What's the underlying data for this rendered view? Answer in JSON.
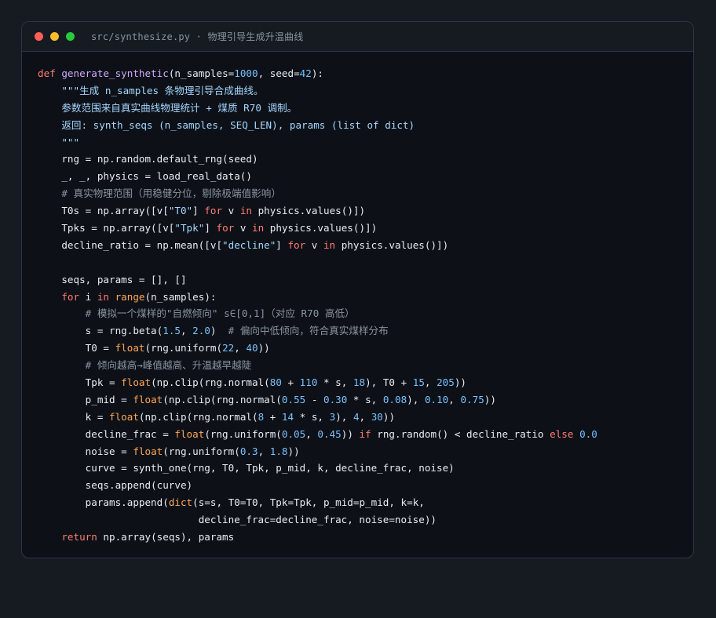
{
  "window": {
    "title": "src/synthesize.py · 物理引导生成升温曲线"
  },
  "colors": {
    "background": "#0d1117",
    "keyword": "#ff7b72",
    "function": "#d2a8ff",
    "number": "#79c0ff",
    "string": "#a5d6ff",
    "comment": "#8b949e",
    "builtin": "#ffa657",
    "plain": "#e6edf3"
  },
  "code": {
    "lines": [
      [
        [
          "kw",
          "def "
        ],
        [
          "fn",
          "generate_synthetic"
        ],
        [
          "pl",
          "(n_samples="
        ],
        [
          "num",
          "1000"
        ],
        [
          "pl",
          ", seed="
        ],
        [
          "num",
          "42"
        ],
        [
          "pl",
          "):"
        ]
      ],
      [
        [
          "str",
          "    \"\"\"生成 n_samples 条物理引导合成曲线。"
        ]
      ],
      [
        [
          "str",
          "    参数范围来自真实曲线物理统计 + 煤质 R70 调制。"
        ]
      ],
      [
        [
          "str",
          "    返回: synth_seqs (n_samples, SEQ_LEN), params (list of dict)"
        ]
      ],
      [
        [
          "str",
          "    \"\"\""
        ]
      ],
      [
        [
          "pl",
          "    rng = np.random.default_rng(seed)"
        ]
      ],
      [
        [
          "pl",
          "    _, _, physics = load_real_data()"
        ]
      ],
      [
        [
          "com",
          "    # 真实物理范围（用稳健分位，剔除极端值影响）"
        ]
      ],
      [
        [
          "pl",
          "    T0s = np.array([v["
        ],
        [
          "str",
          "\"T0\""
        ],
        [
          "pl",
          "] "
        ],
        [
          "kw",
          "for"
        ],
        [
          "pl",
          " v "
        ],
        [
          "kw",
          "in"
        ],
        [
          "pl",
          " physics.values()])"
        ]
      ],
      [
        [
          "pl",
          "    Tpks = np.array([v["
        ],
        [
          "str",
          "\"Tpk\""
        ],
        [
          "pl",
          "] "
        ],
        [
          "kw",
          "for"
        ],
        [
          "pl",
          " v "
        ],
        [
          "kw",
          "in"
        ],
        [
          "pl",
          " physics.values()])"
        ]
      ],
      [
        [
          "pl",
          "    decline_ratio = np.mean([v["
        ],
        [
          "str",
          "\"decline\""
        ],
        [
          "pl",
          "] "
        ],
        [
          "kw",
          "for"
        ],
        [
          "pl",
          " v "
        ],
        [
          "kw",
          "in"
        ],
        [
          "pl",
          " physics.values()])"
        ]
      ],
      [
        [
          "pl",
          ""
        ]
      ],
      [
        [
          "pl",
          "    seqs, params = [], []"
        ]
      ],
      [
        [
          "kw",
          "    for"
        ],
        [
          "pl",
          " i "
        ],
        [
          "kw",
          "in"
        ],
        [
          "pl",
          " "
        ],
        [
          "bi",
          "range"
        ],
        [
          "pl",
          "(n_samples):"
        ]
      ],
      [
        [
          "com",
          "        # 模拟一个煤样的\"自燃倾向\" s∈[0,1]（对应 R70 高低）"
        ]
      ],
      [
        [
          "pl",
          "        s = rng.beta("
        ],
        [
          "num",
          "1.5"
        ],
        [
          "pl",
          ", "
        ],
        [
          "num",
          "2.0"
        ],
        [
          "pl",
          ")  "
        ],
        [
          "com",
          "# 偏向中低倾向，符合真实煤样分布"
        ]
      ],
      [
        [
          "pl",
          "        T0 = "
        ],
        [
          "bi",
          "float"
        ],
        [
          "pl",
          "(rng.uniform("
        ],
        [
          "num",
          "22"
        ],
        [
          "pl",
          ", "
        ],
        [
          "num",
          "40"
        ],
        [
          "pl",
          "))"
        ]
      ],
      [
        [
          "com",
          "        # 倾向越高→峰值越高、升温越早越陡"
        ]
      ],
      [
        [
          "pl",
          "        Tpk = "
        ],
        [
          "bi",
          "float"
        ],
        [
          "pl",
          "(np.clip(rng.normal("
        ],
        [
          "num",
          "80"
        ],
        [
          "pl",
          " + "
        ],
        [
          "num",
          "110"
        ],
        [
          "pl",
          " * s, "
        ],
        [
          "num",
          "18"
        ],
        [
          "pl",
          "), T0 + "
        ],
        [
          "num",
          "15"
        ],
        [
          "pl",
          ", "
        ],
        [
          "num",
          "205"
        ],
        [
          "pl",
          "))"
        ]
      ],
      [
        [
          "pl",
          "        p_mid = "
        ],
        [
          "bi",
          "float"
        ],
        [
          "pl",
          "(np.clip(rng.normal("
        ],
        [
          "num",
          "0.55"
        ],
        [
          "pl",
          " - "
        ],
        [
          "num",
          "0.30"
        ],
        [
          "pl",
          " * s, "
        ],
        [
          "num",
          "0.08"
        ],
        [
          "pl",
          "), "
        ],
        [
          "num",
          "0.10"
        ],
        [
          "pl",
          ", "
        ],
        [
          "num",
          "0.75"
        ],
        [
          "pl",
          "))"
        ]
      ],
      [
        [
          "pl",
          "        k = "
        ],
        [
          "bi",
          "float"
        ],
        [
          "pl",
          "(np.clip(rng.normal("
        ],
        [
          "num",
          "8"
        ],
        [
          "pl",
          " + "
        ],
        [
          "num",
          "14"
        ],
        [
          "pl",
          " * s, "
        ],
        [
          "num",
          "3"
        ],
        [
          "pl",
          "), "
        ],
        [
          "num",
          "4"
        ],
        [
          "pl",
          ", "
        ],
        [
          "num",
          "30"
        ],
        [
          "pl",
          "))"
        ]
      ],
      [
        [
          "pl",
          "        decline_frac = "
        ],
        [
          "bi",
          "float"
        ],
        [
          "pl",
          "(rng.uniform("
        ],
        [
          "num",
          "0.05"
        ],
        [
          "pl",
          ", "
        ],
        [
          "num",
          "0.45"
        ],
        [
          "pl",
          ")) "
        ],
        [
          "kw",
          "if"
        ],
        [
          "pl",
          " rng.random() < decline_ratio "
        ],
        [
          "kw",
          "else"
        ],
        [
          "pl",
          " "
        ],
        [
          "num",
          "0.0"
        ]
      ],
      [
        [
          "pl",
          "        noise = "
        ],
        [
          "bi",
          "float"
        ],
        [
          "pl",
          "(rng.uniform("
        ],
        [
          "num",
          "0.3"
        ],
        [
          "pl",
          ", "
        ],
        [
          "num",
          "1.8"
        ],
        [
          "pl",
          "))"
        ]
      ],
      [
        [
          "pl",
          "        curve = synth_one(rng, T0, Tpk, p_mid, k, decline_frac, noise)"
        ]
      ],
      [
        [
          "pl",
          "        seqs.append(curve)"
        ]
      ],
      [
        [
          "pl",
          "        params.append("
        ],
        [
          "bi",
          "dict"
        ],
        [
          "pl",
          "(s=s, T0=T0, Tpk=Tpk, p_mid=p_mid, k=k,"
        ]
      ],
      [
        [
          "pl",
          "                           decline_frac=decline_frac, noise=noise))"
        ]
      ],
      [
        [
          "kw",
          "    return"
        ],
        [
          "pl",
          " np.array(seqs), params"
        ]
      ]
    ]
  }
}
